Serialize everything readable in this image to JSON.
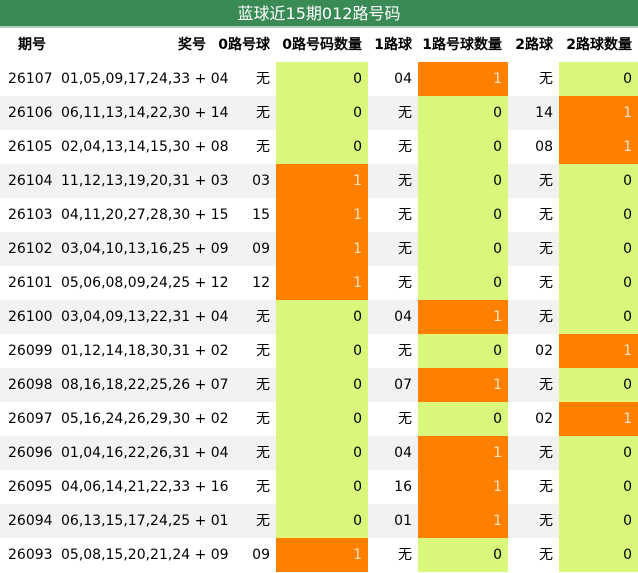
{
  "title": "蓝球近15期012路号码",
  "headers": [
    "期号",
    "奖号",
    "0路号球",
    "0路号码数量",
    "1路球",
    "1路号球数量",
    "2路球",
    "2路球数量"
  ],
  "rows": [
    {
      "issue": "26107",
      "numbers": "01,05,09,17,24,33 + 04",
      "r0": "无",
      "r0_count": "0",
      "r1": "04",
      "r1_count": "1",
      "r2": "无",
      "r2_count": "0"
    },
    {
      "issue": "26106",
      "numbers": "06,11,13,14,22,30 + 14",
      "r0": "无",
      "r0_count": "0",
      "r1": "无",
      "r1_count": "0",
      "r2": "14",
      "r2_count": "1"
    },
    {
      "issue": "26105",
      "numbers": "02,04,13,14,15,30 + 08",
      "r0": "无",
      "r0_count": "0",
      "r1": "无",
      "r1_count": "0",
      "r2": "08",
      "r2_count": "1"
    },
    {
      "issue": "26104",
      "numbers": "11,12,13,19,20,31 + 03",
      "r0": "03",
      "r0_count": "1",
      "r1": "无",
      "r1_count": "0",
      "r2": "无",
      "r2_count": "0"
    },
    {
      "issue": "26103",
      "numbers": "04,11,20,27,28,30 + 15",
      "r0": "15",
      "r0_count": "1",
      "r1": "无",
      "r1_count": "0",
      "r2": "无",
      "r2_count": "0"
    },
    {
      "issue": "26102",
      "numbers": "03,04,10,13,16,25 + 09",
      "r0": "09",
      "r0_count": "1",
      "r1": "无",
      "r1_count": "0",
      "r2": "无",
      "r2_count": "0"
    },
    {
      "issue": "26101",
      "numbers": "05,06,08,09,24,25 + 12",
      "r0": "12",
      "r0_count": "1",
      "r1": "无",
      "r1_count": "0",
      "r2": "无",
      "r2_count": "0"
    },
    {
      "issue": "26100",
      "numbers": "03,04,09,13,22,31 + 04",
      "r0": "无",
      "r0_count": "0",
      "r1": "04",
      "r1_count": "1",
      "r2": "无",
      "r2_count": "0"
    },
    {
      "issue": "26099",
      "numbers": "01,12,14,18,30,31 + 02",
      "r0": "无",
      "r0_count": "0",
      "r1": "无",
      "r1_count": "0",
      "r2": "02",
      "r2_count": "1"
    },
    {
      "issue": "26098",
      "numbers": "08,16,18,22,25,26 + 07",
      "r0": "无",
      "r0_count": "0",
      "r1": "07",
      "r1_count": "1",
      "r2": "无",
      "r2_count": "0"
    },
    {
      "issue": "26097",
      "numbers": "05,16,24,26,29,30 + 02",
      "r0": "无",
      "r0_count": "0",
      "r1": "无",
      "r1_count": "0",
      "r2": "02",
      "r2_count": "1"
    },
    {
      "issue": "26096",
      "numbers": "01,04,16,22,26,31 + 04",
      "r0": "无",
      "r0_count": "0",
      "r1": "04",
      "r1_count": "1",
      "r2": "无",
      "r2_count": "0"
    },
    {
      "issue": "26095",
      "numbers": "04,06,14,21,22,33 + 16",
      "r0": "无",
      "r0_count": "0",
      "r1": "16",
      "r1_count": "1",
      "r2": "无",
      "r2_count": "0"
    },
    {
      "issue": "26094",
      "numbers": "06,13,15,17,24,25 + 01",
      "r0": "无",
      "r0_count": "0",
      "r1": "01",
      "r1_count": "1",
      "r2": "无",
      "r2_count": "0"
    },
    {
      "issue": "26093",
      "numbers": "05,08,15,20,21,24 + 09",
      "r0": "09",
      "r0_count": "1",
      "r1": "无",
      "r1_count": "0",
      "r2": "无",
      "r2_count": "0"
    }
  ],
  "colors": {
    "title_bg": "#3a8a55",
    "zero_fill": "#d9f77a",
    "one_fill": "#ff8000",
    "stripe": "#f2f2f2"
  }
}
